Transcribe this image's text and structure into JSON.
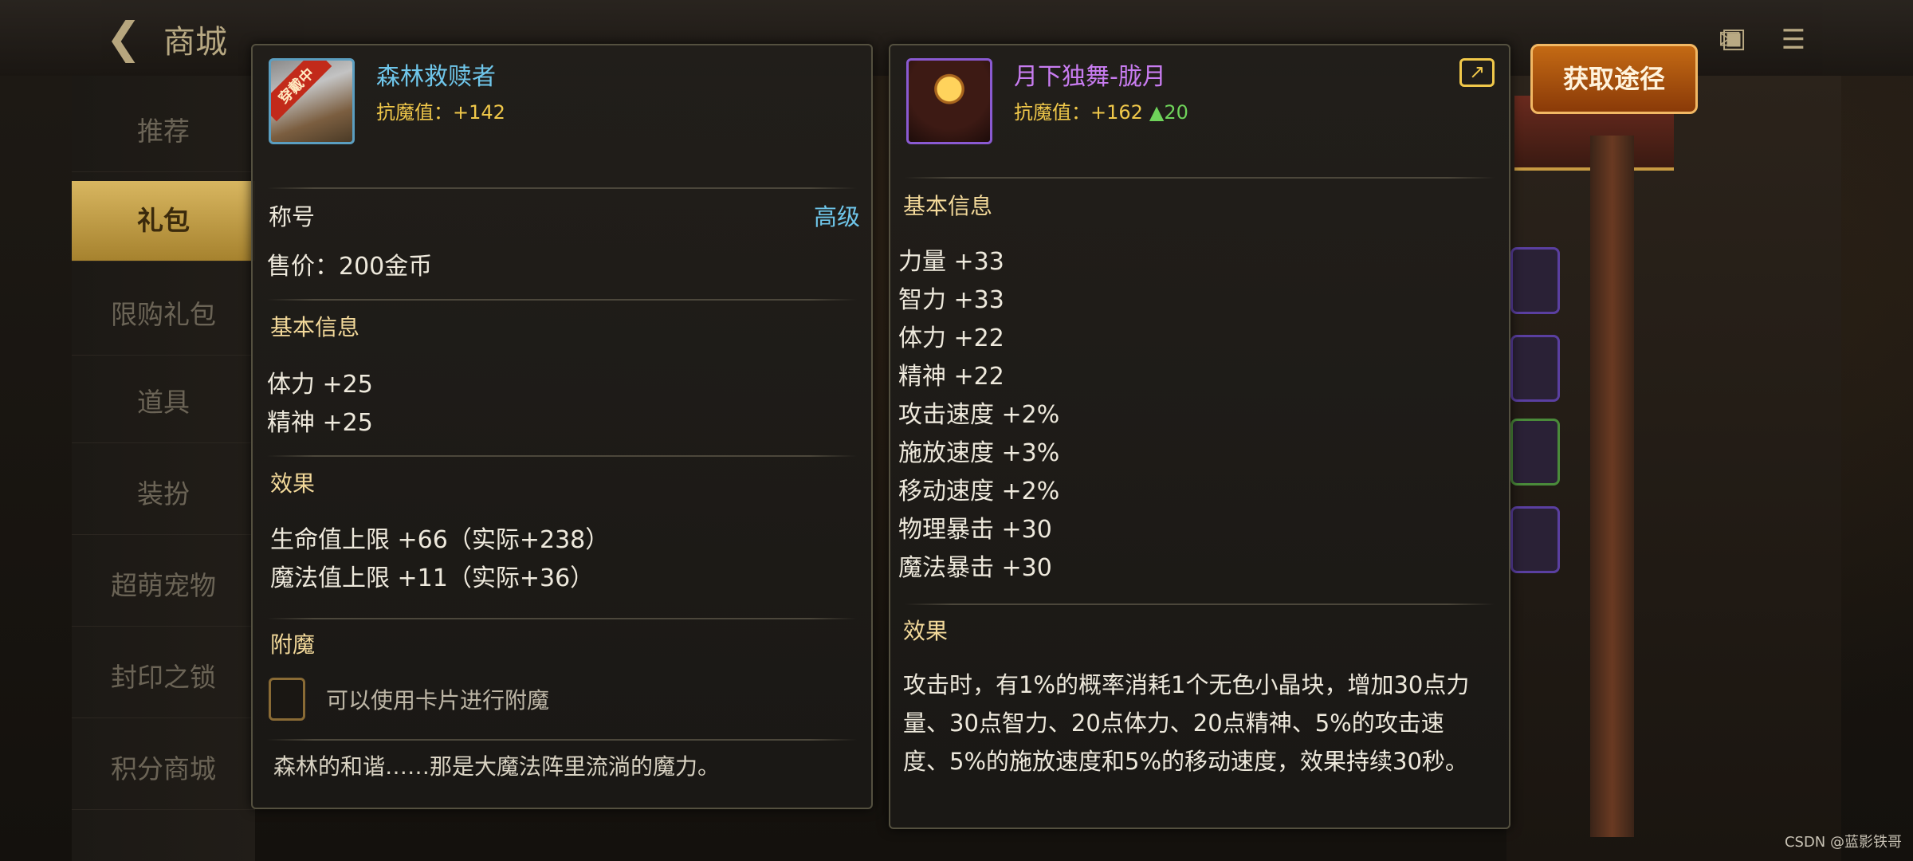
{
  "background": {
    "header": {
      "title": "商城"
    },
    "sidebar": {
      "items": [
        {
          "label": "推荐",
          "active": false
        },
        {
          "label": "礼包",
          "active": true
        },
        {
          "label": "限购礼包",
          "active": false
        },
        {
          "label": "道具",
          "active": false
        },
        {
          "label": "装扮",
          "active": false
        },
        {
          "label": "超萌宠物",
          "active": false
        },
        {
          "label": "封印之锁",
          "active": false
        },
        {
          "label": "积分商城",
          "active": false
        }
      ]
    }
  },
  "left_item": {
    "name": "森林救赎者",
    "badge": "穿戴中",
    "resist_label": "抗魔值：+142",
    "type_label": "称号",
    "grade": "高级",
    "price": "售价：200金币",
    "basic_info_title": "基本信息",
    "basic_stats": [
      "体力 +25",
      "精神 +25"
    ],
    "effect_title": "效果",
    "effects": [
      "生命值上限 +66（实际+238）",
      "魔法值上限 +11（实际+36）"
    ],
    "enchant_title": "附魔",
    "enchant_text": "可以使用卡片进行附魔",
    "flavor_text": "森林的和谐……那是大魔法阵里流淌的魔力。"
  },
  "right_item": {
    "name": "月下独舞-胧月",
    "resist_label": "抗魔值：+162",
    "resist_gain": "▲20",
    "basic_info_title": "基本信息",
    "basic_stats": [
      "力量 +33",
      "智力 +33",
      "体力 +22",
      "精神 +22",
      "攻击速度 +2%",
      "施放速度 +3%",
      "移动速度 +2%",
      "物理暴击 +30",
      "魔法暴击 +30"
    ],
    "effect_title": "效果",
    "effect_lines": [
      "攻击时，有1%的概率消耗1个无色小晶块，增加30点力",
      "量、30点智力、20点体力、20点精神、5%的攻击速",
      "度、5%的施放速度和5%的移动速度，效果持续30秒。"
    ]
  },
  "actions": {
    "obtain_label": "获取途径"
  },
  "watermark": "CSDN @蓝影铁哥",
  "colors": {
    "left_name": "#6fc6ea",
    "right_name": "#c87cf0",
    "resist": "#f0c84a",
    "gain": "#6fd35a",
    "section_title": "#f3d99a",
    "button": "#c46a14"
  },
  "icons": [
    "back-arrow-icon",
    "share-icon",
    "mail-icon",
    "chat-icon"
  ]
}
